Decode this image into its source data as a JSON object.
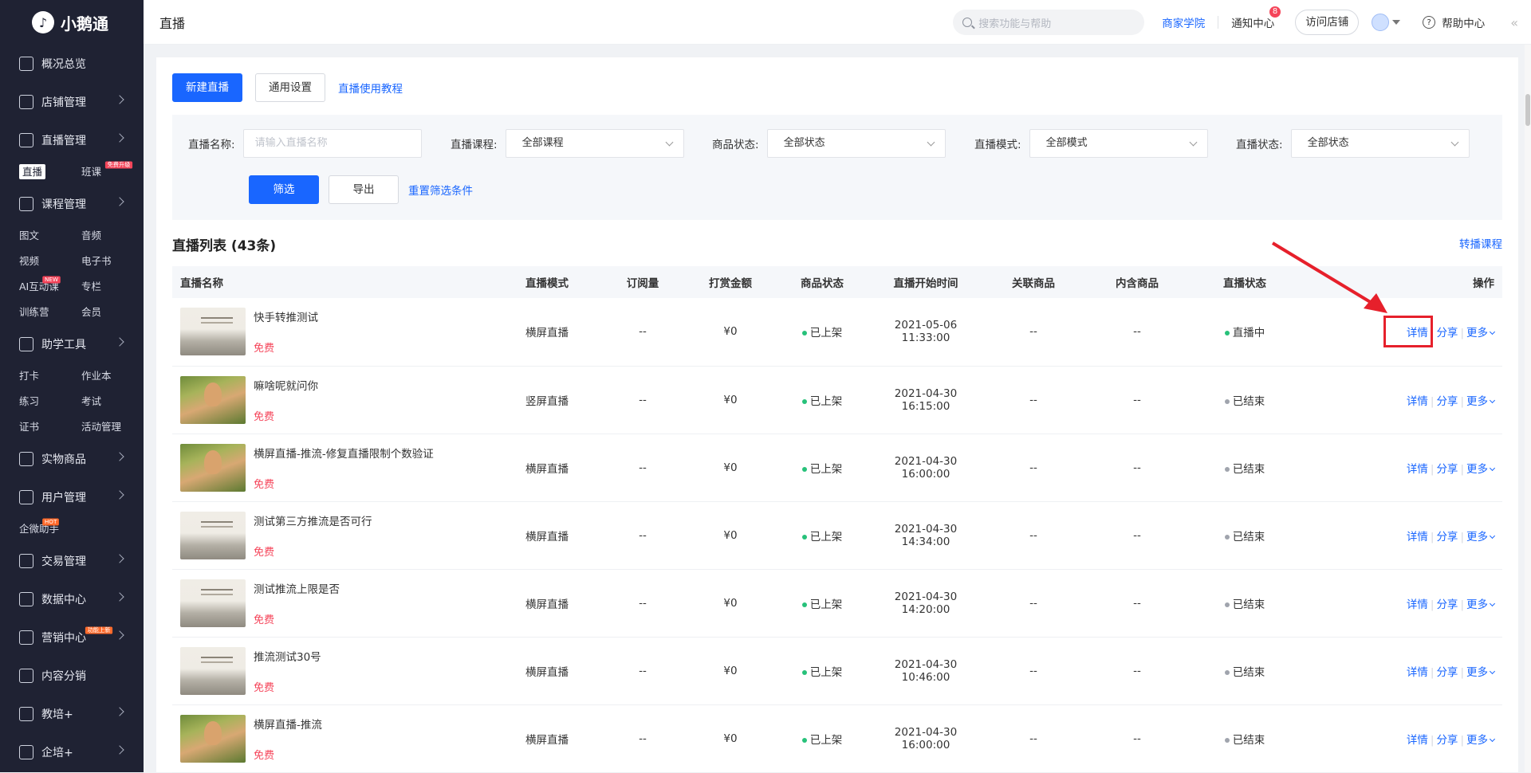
{
  "app": {
    "logo": "小鹅通",
    "logo_mark": "♪"
  },
  "sidebar": {
    "items": [
      {
        "label": "概况总览",
        "icon": "overview-icon",
        "has_chevron": false
      },
      {
        "label": "店铺管理",
        "icon": "store-icon",
        "has_chevron": true
      },
      {
        "label": "直播管理",
        "icon": "live-icon",
        "has_chevron": true
      },
      {
        "label": "课程管理",
        "icon": "course-icon",
        "has_chevron": true
      },
      {
        "label": "助学工具",
        "icon": "toolbox-icon",
        "has_chevron": true
      },
      {
        "label": "实物商品",
        "icon": "goods-icon",
        "has_chevron": true
      },
      {
        "label": "用户管理",
        "icon": "user-icon",
        "has_chevron": true
      },
      {
        "label": "交易管理",
        "icon": "trade-icon",
        "has_chevron": true
      },
      {
        "label": "数据中心",
        "icon": "data-icon",
        "has_chevron": true
      },
      {
        "label": "营销中心",
        "icon": "marketing-icon",
        "has_chevron": true
      },
      {
        "label": "内容分销",
        "icon": "distribution-icon",
        "has_chevron": false
      },
      {
        "label": "教培+",
        "icon": "edu-icon",
        "has_chevron": true
      },
      {
        "label": "企培+",
        "icon": "enterprise-icon",
        "has_chevron": true
      }
    ],
    "live_sub": [
      {
        "label": "直播",
        "active": true
      },
      {
        "label": "班课",
        "tag": "免费升级"
      }
    ],
    "course_sub": [
      {
        "label": "图文"
      },
      {
        "label": "音频"
      },
      {
        "label": "视频"
      },
      {
        "label": "电子书"
      },
      {
        "label": "AI互动课",
        "tag": "NEW"
      },
      {
        "label": "专栏"
      },
      {
        "label": "训练营"
      },
      {
        "label": "会员"
      }
    ],
    "tools_sub": [
      {
        "label": "打卡"
      },
      {
        "label": "作业本"
      },
      {
        "label": "练习"
      },
      {
        "label": "考试"
      },
      {
        "label": "证书"
      },
      {
        "label": "活动管理"
      }
    ],
    "user_sub": [
      {
        "label": "企微助手",
        "tag": "HOT"
      }
    ],
    "marketing_tag": "功能上新"
  },
  "topbar": {
    "title": "直播",
    "search_placeholder": "搜索功能与帮助",
    "merchant_academy": "商家学院",
    "notifications": "通知中心",
    "notification_count": "8",
    "visit_store": "访问店铺",
    "help_center": "帮助中心",
    "collapse_icon": "«"
  },
  "actions": {
    "new_live": "新建直播",
    "general_settings": "通用设置",
    "tutorial": "直播使用教程"
  },
  "filters": {
    "name_label": "直播名称:",
    "name_placeholder": "请输入直播名称",
    "course_label": "直播课程:",
    "course_value": "全部课程",
    "goods_status_label": "商品状态:",
    "goods_status_value": "全部状态",
    "mode_label": "直播模式:",
    "mode_value": "全部模式",
    "live_status_label": "直播状态:",
    "live_status_value": "全部状态",
    "filter_button": "筛选",
    "export_button": "导出",
    "reset_link": "重置筛选条件"
  },
  "list": {
    "title": "直播列表 (43条)",
    "transfer_link": "转播课程",
    "headers": [
      "直播名称",
      "直播模式",
      "订阅量",
      "打赏金额",
      "商品状态",
      "直播开始时间",
      "关联商品",
      "内含商品",
      "直播状态",
      "操作"
    ],
    "rows": [
      {
        "name": "快手转推测试",
        "price": "免费",
        "thumb": "paint",
        "mode": "横屏直播",
        "subs": "--",
        "reward": "¥0",
        "goods_status": "已上架",
        "date": "2021-05-06",
        "time": "11:33:00",
        "related": "--",
        "included": "--",
        "status": "直播中",
        "status_color": "green"
      },
      {
        "name": "嘛啥呢就问你",
        "price": "免费",
        "thumb": "photo",
        "mode": "竖屏直播",
        "subs": "--",
        "reward": "¥0",
        "goods_status": "已上架",
        "date": "2021-04-30",
        "time": "16:15:00",
        "related": "--",
        "included": "--",
        "status": "已结束",
        "status_color": "gray"
      },
      {
        "name": "横屏直播-推流-修复直播限制个数验证",
        "price": "免费",
        "thumb": "photo",
        "mode": "横屏直播",
        "subs": "--",
        "reward": "¥0",
        "goods_status": "已上架",
        "date": "2021-04-30",
        "time": "16:00:00",
        "related": "--",
        "included": "--",
        "status": "已结束",
        "status_color": "gray"
      },
      {
        "name": "测试第三方推流是否可行",
        "price": "免费",
        "thumb": "paint",
        "mode": "横屏直播",
        "subs": "--",
        "reward": "¥0",
        "goods_status": "已上架",
        "date": "2021-04-30",
        "time": "14:34:00",
        "related": "--",
        "included": "--",
        "status": "已结束",
        "status_color": "gray"
      },
      {
        "name": "测试推流上限是否",
        "price": "免费",
        "thumb": "paint",
        "mode": "横屏直播",
        "subs": "--",
        "reward": "¥0",
        "goods_status": "已上架",
        "date": "2021-04-30",
        "time": "14:20:00",
        "related": "--",
        "included": "--",
        "status": "已结束",
        "status_color": "gray"
      },
      {
        "name": "推流测试30号",
        "price": "免费",
        "thumb": "paint",
        "mode": "横屏直播",
        "subs": "--",
        "reward": "¥0",
        "goods_status": "已上架",
        "date": "2021-04-30",
        "time": "10:46:00",
        "related": "--",
        "included": "--",
        "status": "已结束",
        "status_color": "gray"
      },
      {
        "name": "横屏直播-推流",
        "price": "免费",
        "thumb": "photo",
        "mode": "横屏直播",
        "subs": "--",
        "reward": "¥0",
        "goods_status": "已上架",
        "date": "2021-04-30",
        "time": "16:00:00",
        "related": "--",
        "included": "--",
        "status": "已结束",
        "status_color": "gray"
      }
    ],
    "ops": {
      "detail": "详情",
      "share": "分享",
      "more": "更多"
    }
  },
  "colors": {
    "accent": "#1966ff",
    "danger": "#f5455a",
    "sidebar_bg": "#1f2233",
    "annotation_red": "#e6202b"
  }
}
